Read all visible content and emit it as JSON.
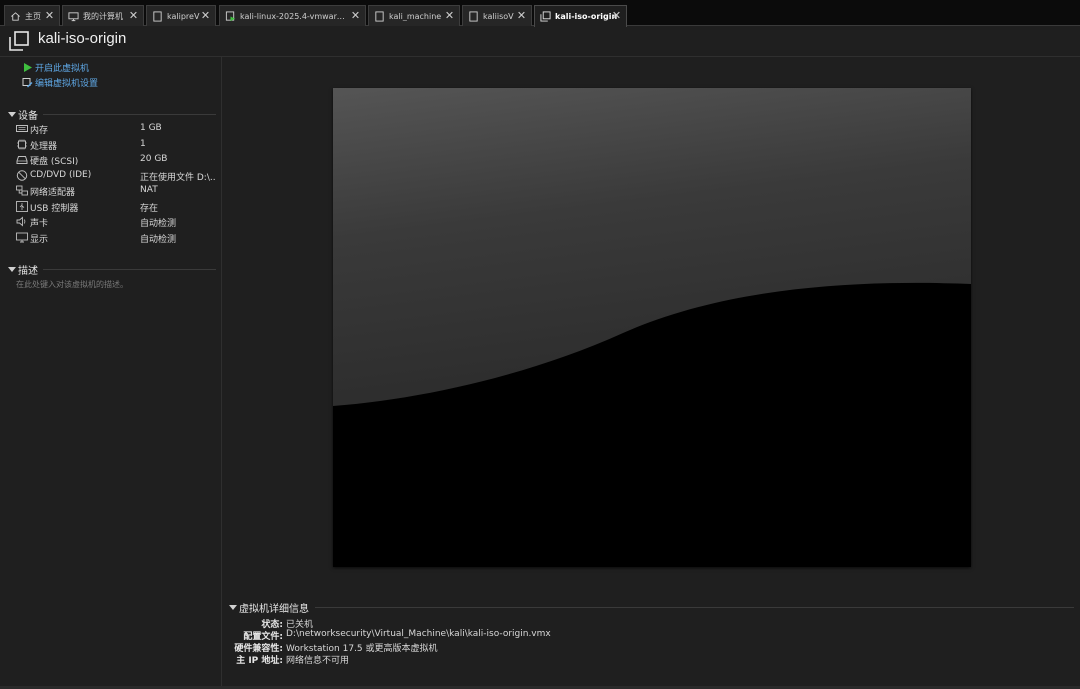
{
  "tabs": [
    {
      "label": "主页",
      "icon": "home-icon",
      "active": false
    },
    {
      "label": "我的计算机",
      "icon": "monitor-icon",
      "active": false
    },
    {
      "label": "kalipreV",
      "icon": "vm-doc-icon",
      "active": false
    },
    {
      "label": "kali-linux-2025.4-vmware-am...",
      "icon": "vm-running-icon",
      "active": false
    },
    {
      "label": "kali_machine",
      "icon": "vm-doc-icon",
      "active": false
    },
    {
      "label": "kaliisoV",
      "icon": "vm-doc-icon",
      "active": false
    },
    {
      "label": "kali-iso-origin",
      "icon": "vm-copy-icon",
      "active": true
    }
  ],
  "tab_close_glyph": "✕",
  "vm": {
    "title": "kali-iso-origin",
    "title_icon": "vm-copy-icon"
  },
  "actions": {
    "power_on": "开启此虚拟机",
    "edit_settings": "编辑虚拟机设置"
  },
  "devices": {
    "header": "设备",
    "items": [
      {
        "name": "内存",
        "value": "1 GB",
        "icon": "memory-icon"
      },
      {
        "name": "处理器",
        "value": "1",
        "icon": "processor-icon"
      },
      {
        "name": "硬盘 (SCSI)",
        "value": "20 GB",
        "icon": "hard-disk-icon"
      },
      {
        "name": "CD/DVD (IDE)",
        "value": "正在使用文件 D:\\...",
        "icon": "cd-dvd-icon"
      },
      {
        "name": "网络适配器",
        "value": "NAT",
        "icon": "network-adapter-icon"
      },
      {
        "name": "USB 控制器",
        "value": "存在",
        "icon": "usb-controller-icon"
      },
      {
        "name": "声卡",
        "value": "自动检测",
        "icon": "sound-card-icon"
      },
      {
        "name": "显示",
        "value": "自动检测",
        "icon": "display-icon"
      }
    ]
  },
  "description": {
    "header": "描述",
    "placeholder": "在此处键入对该虚拟机的描述。"
  },
  "details": {
    "header": "虚拟机详细信息",
    "rows": [
      {
        "key": "状态:",
        "value": "已关机"
      },
      {
        "key": "配置文件:",
        "value": "D:\\networksecurity\\Virtual_Machine\\kali\\kali-iso-origin.vmx"
      },
      {
        "key": "硬件兼容性:",
        "value": "Workstation 17.5 或更高版本虚拟机"
      },
      {
        "key": "主 IP 地址:",
        "value": "网络信息不可用"
      }
    ]
  },
  "colors": {
    "accent_link": "#5fa8e6",
    "play_green": "#3fbf3f",
    "background": "#1f1f1f",
    "tabbar": "#0b0b0b"
  }
}
